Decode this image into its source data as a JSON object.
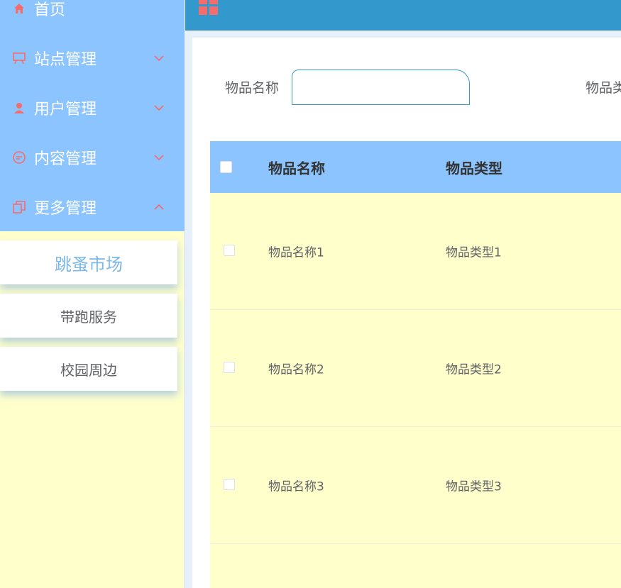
{
  "sidebar": {
    "menu": [
      {
        "label": "首页",
        "icon": "home-icon"
      },
      {
        "label": "站点管理",
        "icon": "easel-icon"
      },
      {
        "label": "用户管理",
        "icon": "user-icon"
      },
      {
        "label": "内容管理",
        "icon": "chat-icon"
      },
      {
        "label": "更多管理",
        "icon": "copy-icon"
      }
    ],
    "submenu": [
      {
        "label": "跳蚤市场",
        "active": true
      },
      {
        "label": "带跑服务",
        "active": false
      },
      {
        "label": "校园周边",
        "active": false
      }
    ]
  },
  "search": {
    "label1": "物品名称",
    "value1": "",
    "label2": "物品类"
  },
  "table": {
    "headers": [
      "物品名称",
      "物品类型"
    ],
    "rows": [
      {
        "name": "物品名称1",
        "type": "物品类型1"
      },
      {
        "name": "物品名称2",
        "type": "物品类型2"
      },
      {
        "name": "物品名称3",
        "type": "物品类型3"
      }
    ]
  },
  "colors": {
    "sidebar_blue": "#8bc4ff",
    "sidebar_yellow": "#ffffcc",
    "topbar": "#3399cc",
    "icon_accent": "#f56c6c",
    "active_sub": "#7cb7e6"
  }
}
